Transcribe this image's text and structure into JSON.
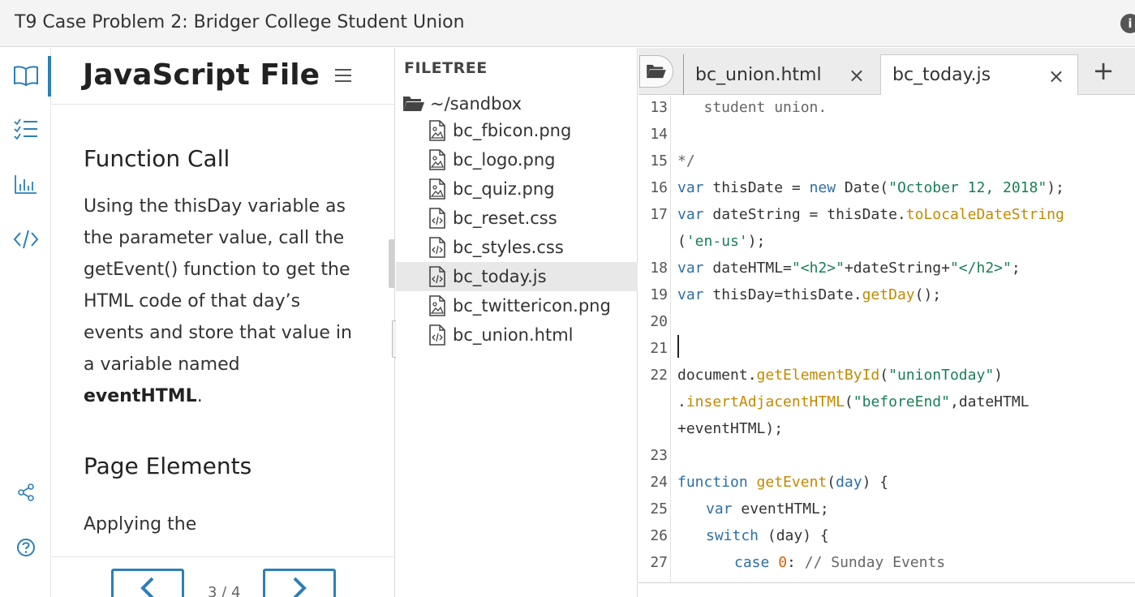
{
  "window": {
    "title": "T9 Case Problem 2: Bridger College Student Union"
  },
  "rail": {
    "items": [
      {
        "name": "book-icon"
      },
      {
        "name": "checklist-icon"
      },
      {
        "name": "bar-chart-icon"
      },
      {
        "name": "code-icon"
      },
      {
        "name": "share-icon"
      },
      {
        "name": "help-icon"
      }
    ]
  },
  "instructions": {
    "title": "JavaScript File",
    "section1_heading": "Function Call",
    "para_before_bold": "Using the thisDay variable as the parameter value, call the getEvent() function to get the HTML code of that day’s events and store that value in a variable named ",
    "para_bold": "eventHTML",
    "para_after_bold": ".",
    "section2_heading": "Page Elements",
    "tail_text": "Applying the",
    "pager": "3 / 4"
  },
  "filetree": {
    "heading": "FILETREE",
    "root": "~/sandbox",
    "files": [
      {
        "name": "bc_fbicon.png",
        "type": "image"
      },
      {
        "name": "bc_logo.png",
        "type": "image"
      },
      {
        "name": "bc_quiz.png",
        "type": "image"
      },
      {
        "name": "bc_reset.css",
        "type": "code"
      },
      {
        "name": "bc_styles.css",
        "type": "code"
      },
      {
        "name": "bc_today.js",
        "type": "code",
        "active": true
      },
      {
        "name": "bc_twittericon.png",
        "type": "image"
      },
      {
        "name": "bc_union.html",
        "type": "code"
      }
    ]
  },
  "editor": {
    "tabs": [
      {
        "label": "bc_union.html",
        "close": "×"
      },
      {
        "label": "bc_today.js",
        "close": "×",
        "active": true
      }
    ],
    "new_tab": "+",
    "line_numbers": [
      "13",
      "14",
      "15",
      "16",
      "17",
      "18",
      "19",
      "20",
      "21",
      "22",
      "23",
      "24",
      "25",
      "26",
      "27"
    ],
    "code": {
      "l13": "   student union.",
      "l15": "*/",
      "l16_kw": "var",
      "l16_a": " thisDate = ",
      "l16_kw2": "new",
      "l16_b": " Date(",
      "l16_str": "\"October 12, 2018\"",
      "l16_c": ");",
      "l17_kw": "var",
      "l17_a": " dateString = thisDate.",
      "l17_fn": "toLocaleDateString",
      "l17w_a": "(",
      "l17w_str": "'en-us'",
      "l17w_b": ");",
      "l18_kw": "var",
      "l18_a": " dateHTML=",
      "l18_str1": "\"<h2>\"",
      "l18_b": "+dateString+",
      "l18_str2": "\"</h2>\"",
      "l18_c": ";",
      "l19_kw": "var",
      "l19_a": " thisDay=thisDate.",
      "l19_fn": "getDay",
      "l19_b": "();",
      "l22_a": "document.",
      "l22_fn": "getElementById",
      "l22_b": "(",
      "l22_str": "\"unionToday\"",
      "l22_c": ")",
      "l22w1_a": ".",
      "l22w1_fn": "insertAdjacentHTML",
      "l22w1_b": "(",
      "l22w1_str": "\"beforeEnd\"",
      "l22w1_c": ",dateHTML",
      "l22w2": "+eventHTML);",
      "l24_kw": "function",
      "l24_fn": "getEvent",
      "l24_b": "(",
      "l24_param": "day",
      "l24_c": ") {",
      "l25_kw": "var",
      "l25_a": " eventHTML;",
      "l26_kw": "switch",
      "l26_a": " (day) {",
      "l27_kw": "case",
      "l27_num": "0",
      "l27_a": ": ",
      "l27_cm": "// Sunday Events"
    }
  },
  "colors": {
    "accent": "#2d7fb8",
    "keyword": "#2d6fa3",
    "string": "#1a7f55",
    "function": "#c28a00",
    "number": "#d4620a"
  }
}
